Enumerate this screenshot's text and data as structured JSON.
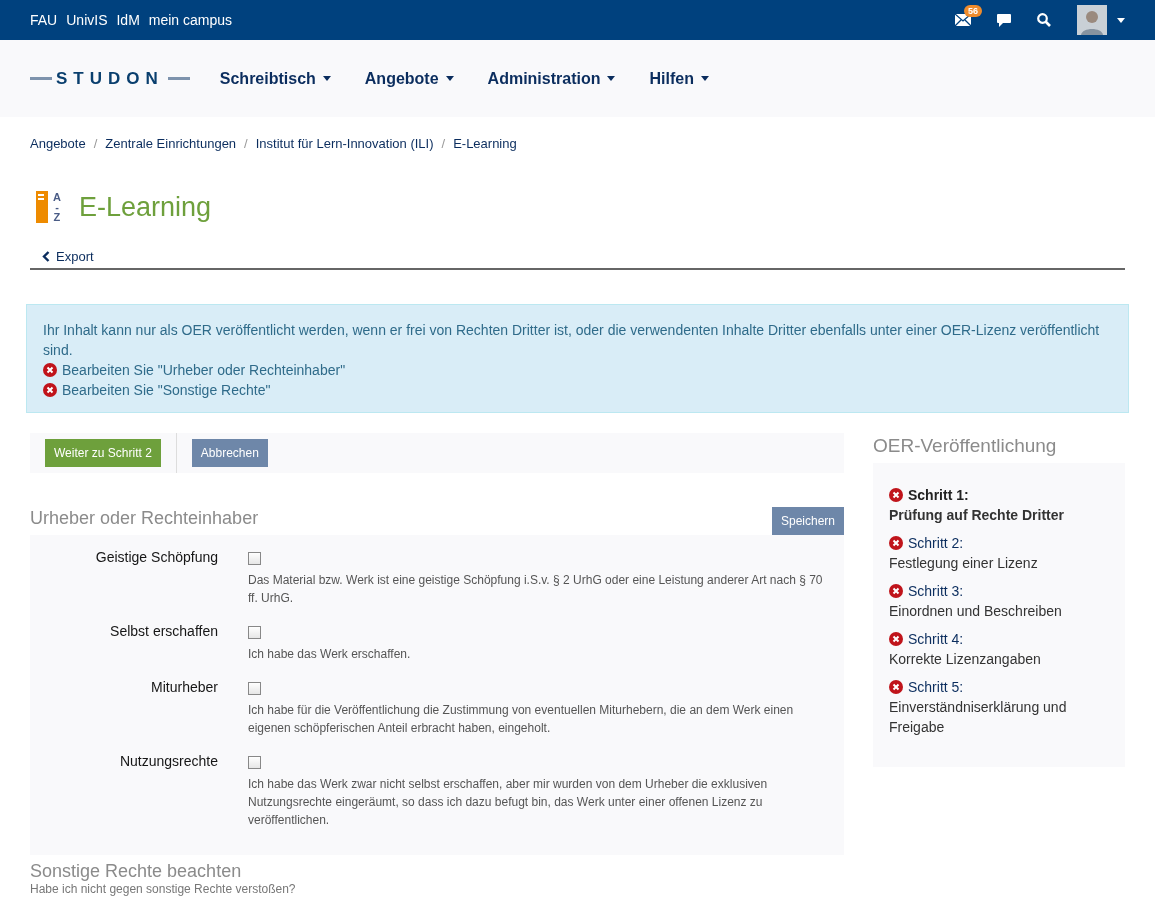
{
  "top_links": [
    "FAU",
    "UnivIS",
    "IdM",
    "mein campus"
  ],
  "mail_badge": "56",
  "logo": "STUDON",
  "nav": [
    "Schreibtisch",
    "Angebote",
    "Administration",
    "Hilfen"
  ],
  "breadcrumb_separator": "/",
  "breadcrumbs": [
    "Angebote",
    "Zentrale Einrichtungen",
    "Institut für Lern-Innovation (ILI)",
    "E-Learning"
  ],
  "title": "E-Learning",
  "title_icon_letters": [
    "A",
    "-",
    "Z"
  ],
  "back_link": "Export",
  "alert": {
    "text": "Ihr Inhalt kann nur als OER veröffentlicht werden, wenn er frei von Rechten Dritter ist, oder die verwendenten Inhalte Dritter ebenfalls unter einer OER-Lizenz veröffentlicht sind.",
    "items": [
      "Bearbeiten Sie \"Urheber oder Rechteinhaber\"",
      "Bearbeiten Sie \"Sonstige Rechte\""
    ]
  },
  "toolbar": {
    "primary": "Weiter zu Schritt 2",
    "secondary": "Abbrechen"
  },
  "section": {
    "title": "Urheber oder Rechteinhaber",
    "save": "Speichern",
    "fields": [
      {
        "label": "Geistige Schöpfung",
        "checked": false,
        "info": "Das Material bzw. Werk ist eine geistige Schöpfung i.S.v. § 2 UrhG oder eine Leistung anderer Art nach § 70 ff. UrhG."
      },
      {
        "label": "Selbst erschaffen",
        "checked": false,
        "info": "Ich habe das Werk erschaffen."
      },
      {
        "label": "Miturheber",
        "checked": false,
        "info": "Ich habe für die Veröffentlichung die Zustimmung von eventuellen Miturhebern, die an dem Werk einen eigenen schöpferischen Anteil erbracht haben, eingeholt."
      },
      {
        "label": "Nutzungsrechte",
        "checked": false,
        "info": "Ich habe das Werk zwar nicht selbst erschaffen, aber mir wurden von dem Urheber die exklusiven Nutzungsrechte eingeräumt, so dass ich dazu befugt bin, das Werk unter einer offenen Lizenz zu veröffentlichen."
      }
    ]
  },
  "section2": {
    "title": "Sonstige Rechte beachten",
    "subtitle": "Habe ich nicht gegen sonstige Rechte verstoßen?"
  },
  "sidebar": {
    "title": "OER-Veröffentlichung",
    "steps": [
      {
        "step": "Schritt 1:",
        "name": "Prüfung auf Rechte Dritter",
        "selected": true
      },
      {
        "step": "Schritt 2:",
        "name": "Festlegung einer Lizenz",
        "selected": false
      },
      {
        "step": "Schritt 3:",
        "name": "Einordnen und Beschreiben",
        "selected": false
      },
      {
        "step": "Schritt 4:",
        "name": "Korrekte Lizenzangaben",
        "selected": false
      },
      {
        "step": "Schritt 5:",
        "name": "Einverständniserklärung und Freigabe",
        "selected": false
      }
    ]
  }
}
